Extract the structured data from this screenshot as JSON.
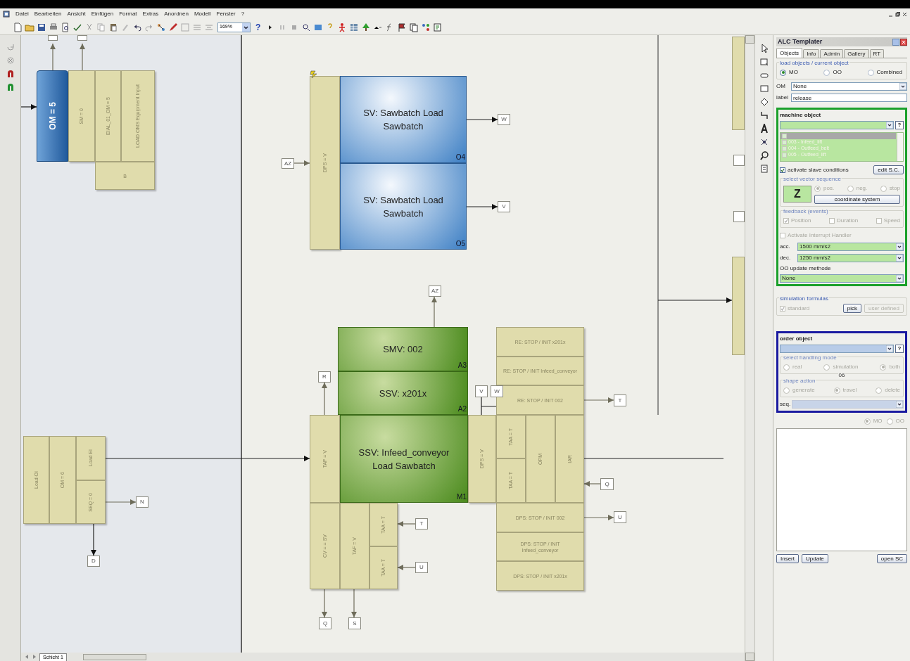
{
  "menu": [
    "Datei",
    "Bearbeiten",
    "Ansicht",
    "Einfügen",
    "Format",
    "Extras",
    "Anordnen",
    "Modell",
    "Fenster",
    "?"
  ],
  "toolbar": {
    "zoom": "169%",
    "help": "?"
  },
  "diagram": {
    "blocks": [
      {
        "text": "OM = 5",
        "kind": "blue-vertical"
      },
      {
        "text": "SM = 0",
        "kind": "beige-vertical"
      },
      {
        "text": "EIAL_01_OM = 5",
        "kind": "beige-vertical"
      },
      {
        "text": "LOAD OMS Equipment Input",
        "kind": "beige-vertical"
      },
      {
        "text": "B",
        "kind": "beige"
      },
      {
        "text": "DPS = V",
        "kind": "beige-vertical"
      },
      {
        "text": "SV: Sawbatch Load Sawbatch",
        "kind": "blue",
        "corner": "O4"
      },
      {
        "text": "SV: Sawbatch Load Sawbatch",
        "kind": "blue",
        "corner": "O5"
      },
      {
        "text": "SMV: 002",
        "kind": "green",
        "corner": "A3"
      },
      {
        "text": "SSV: x201x",
        "kind": "green",
        "corner": "A2"
      },
      {
        "text": "RE: STOP / INIT x201x",
        "kind": "beige"
      },
      {
        "text": "RE: STOP / INIT Infeed_conveyor",
        "kind": "beige"
      },
      {
        "text": "RE: STOP / INIT 002",
        "kind": "beige"
      },
      {
        "text": "TAF = V",
        "kind": "beige-vertical"
      },
      {
        "text": "SSV: Infeed_conveyor Load Sawbatch",
        "kind": "green",
        "corner": "M1"
      },
      {
        "text": "DPS = V",
        "kind": "beige-vertical"
      },
      {
        "text": "TAA = T",
        "kind": "beige-vertical"
      },
      {
        "text": "TAA = T",
        "kind": "beige-vertical"
      },
      {
        "text": "OPM",
        "kind": "beige-vertical"
      },
      {
        "text": "IAR",
        "kind": "beige-vertical"
      },
      {
        "text": "Load OI",
        "kind": "beige-vertical"
      },
      {
        "text": "OM = 6",
        "kind": "beige-vertical"
      },
      {
        "text": "Load EI",
        "kind": "beige-vertical"
      },
      {
        "text": "SEQ = 0",
        "kind": "beige-vertical"
      },
      {
        "text": "DPS: STOP / INIT 002",
        "kind": "beige"
      },
      {
        "text": "DPS: STOP / INIT Infeed_conveyor",
        "kind": "beige"
      },
      {
        "text": "DPS: STOP / INIT x201x",
        "kind": "beige"
      },
      {
        "text": "CV = = SV",
        "kind": "beige-vertical"
      },
      {
        "text": "TAF = V",
        "kind": "beige-vertical"
      },
      {
        "text": "TAA = T",
        "kind": "beige-vertical"
      },
      {
        "text": "TAA = T",
        "kind": "beige-vertical"
      }
    ],
    "tags": [
      "AZ",
      "W",
      "V",
      "AZ",
      "R",
      "V",
      "W",
      "T",
      "Q",
      "N",
      "T",
      "U",
      "U",
      "D",
      "Q",
      "S"
    ]
  },
  "sheet_tab": "Schicht 1",
  "panel": {
    "title": "ALC Templater",
    "tabs": [
      {
        "label": "Objects",
        "selected": true
      },
      {
        "label": "Info",
        "selected": false
      },
      {
        "label": "Admin",
        "selected": false
      },
      {
        "label": "Gallery",
        "selected": false
      },
      {
        "label": "RT",
        "selected": false
      }
    ],
    "load_group": {
      "legend": "load objects / current object",
      "options": [
        {
          "label": "MO",
          "selected": true
        },
        {
          "label": "OO",
          "selected": false
        },
        {
          "label": "Combined",
          "selected": false
        }
      ]
    },
    "om": {
      "label": "OM",
      "value": "None"
    },
    "label_field": {
      "label": "label",
      "value": "release"
    },
    "machine_object": {
      "title": "machine object",
      "help": "?",
      "list": [
        {
          "selected": true,
          "checked": false
        },
        {
          "label": "003 - Infeed_lift",
          "selected": false,
          "checked": false
        },
        {
          "label": "004 - Outfeed_belt",
          "selected": false,
          "checked": false
        },
        {
          "label": "005 - Outfeed_lift",
          "selected": false,
          "checked": false
        }
      ],
      "slave": {
        "label": "activate slave conditions",
        "checked": true
      },
      "edit_button": "edit S.C.",
      "vector": {
        "legend": "select vector sequence",
        "axis": "Z",
        "disabled": true,
        "options": [
          {
            "label": "pos.",
            "selected": true
          },
          {
            "label": "neg.",
            "selected": false
          },
          {
            "label": "stop",
            "selected": false
          }
        ],
        "button": "coordinate system"
      },
      "feedback": {
        "legend": "feedback (events)",
        "disabled": true,
        "options": [
          {
            "label": "Position",
            "checked": true
          },
          {
            "label": "Duration",
            "checked": false
          },
          {
            "label": "Speed",
            "checked": false
          }
        ]
      },
      "interrupt": {
        "label": "Activate Interrupt Handler",
        "checked": false,
        "disabled": true
      },
      "acc": {
        "label": "acc.",
        "value": "1500 mm/s2"
      },
      "dec": {
        "label": "dec.",
        "value": "1250 mm/s2"
      },
      "update": {
        "label": "OO update methode",
        "value": "None"
      }
    },
    "simulation": {
      "legend": "simulation formulas",
      "standard": {
        "label": "standard",
        "checked": true,
        "disabled": true
      },
      "buttons": [
        {
          "label": "pick",
          "disabled": false
        },
        {
          "label": "user defined",
          "disabled": true
        }
      ]
    },
    "order_object": {
      "title": "order object",
      "help": "?",
      "handling": {
        "legend": "select handling mode",
        "disabled": true,
        "options": [
          {
            "label": "real",
            "selected": false
          },
          {
            "label": "simulation",
            "selected": false
          },
          {
            "label": "both",
            "selected": true
          }
        ]
      },
      "note": "06",
      "shape": {
        "legend": "shape action",
        "disabled": true,
        "options": [
          {
            "label": "generate",
            "selected": false
          },
          {
            "label": "travel",
            "selected": true
          },
          {
            "label": "delete",
            "selected": false
          }
        ]
      },
      "seq": {
        "label": "seq.",
        "disabled": true
      }
    },
    "target": {
      "disabled": true,
      "options": [
        {
          "label": "MO",
          "selected": true
        },
        {
          "label": "OO",
          "selected": false
        }
      ]
    },
    "buttons": [
      "Insert",
      "Update",
      "open SC"
    ]
  }
}
